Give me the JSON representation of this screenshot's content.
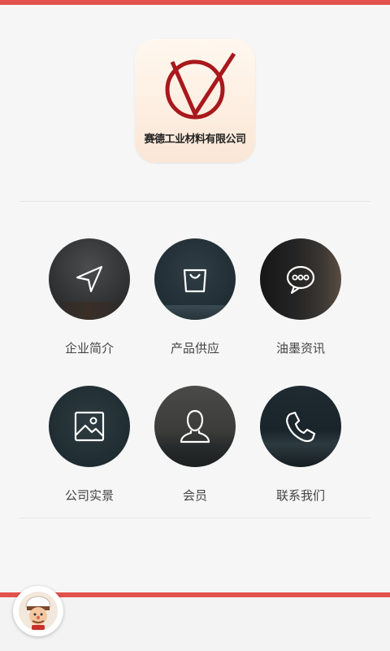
{
  "brand": {
    "company_name": "赛德工业材料有限公司",
    "logo_color": "#a8181c"
  },
  "menu": [
    {
      "label": "企业简介",
      "icon": "navigation-arrow-icon"
    },
    {
      "label": "产品供应",
      "icon": "shopping-bag-icon"
    },
    {
      "label": "油墨资讯",
      "icon": "chat-bubble-icon"
    },
    {
      "label": "公司实景",
      "icon": "picture-icon"
    },
    {
      "label": "会员",
      "icon": "user-icon"
    },
    {
      "label": "联系我们",
      "icon": "phone-icon"
    }
  ],
  "colors": {
    "accent": "#e1534c",
    "label_text": "#444444",
    "icon_stroke": "#ffffff"
  },
  "footer": {
    "avatar_icon": "chef-mascot-icon"
  }
}
